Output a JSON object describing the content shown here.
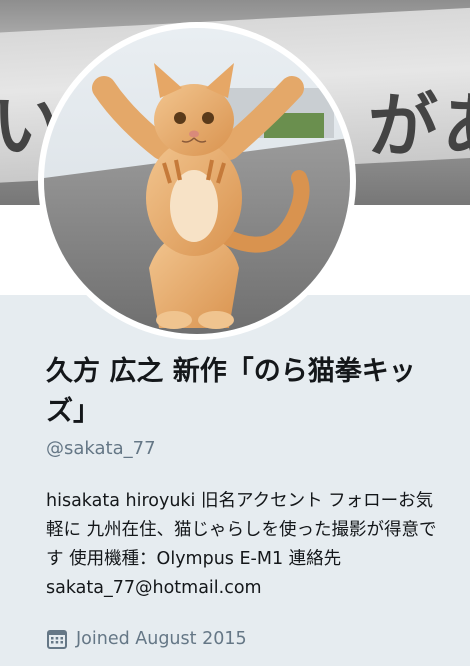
{
  "banner": {
    "text_left": "い",
    "text_right": "があっ"
  },
  "profile": {
    "display_name": "久方 広之 新作「のら猫拳キッズ」",
    "handle": "@sakata_77",
    "bio": "hisakata hiroyuki 旧名アクセント フォローお気軽に 九州在住、猫じゃらしを使った撮影が得意です 使用機種：Olympus E-M1 連絡先 sakata_77@hotmail.com",
    "joined": "Joined August 2015"
  },
  "icons": {
    "joined": "calendar-icon",
    "avatar": "cat-photo"
  },
  "colors": {
    "background": "#e6ecf0",
    "name": "#14171a",
    "secondary": "#657786"
  }
}
